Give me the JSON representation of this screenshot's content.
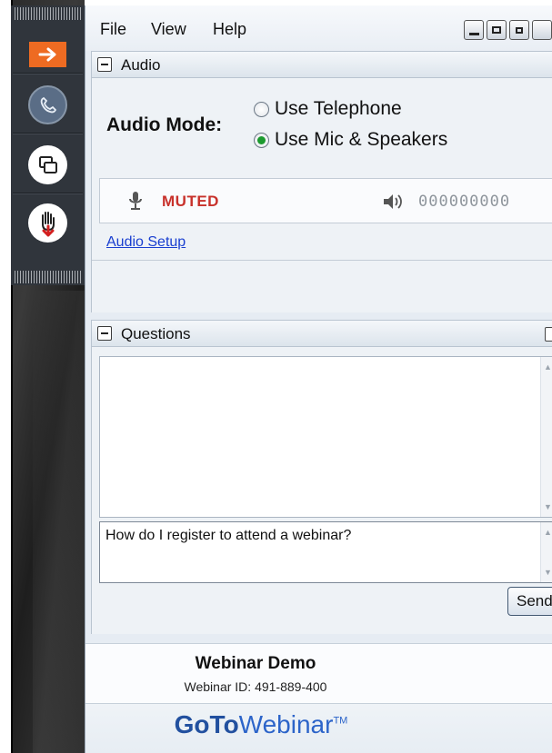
{
  "menu": {
    "items": [
      "File",
      "View",
      "Help"
    ]
  },
  "audio": {
    "section_title": "Audio",
    "mode_label": "Audio Mode:",
    "options": [
      "Use Telephone",
      "Use Mic & Speakers"
    ],
    "selected": "Use Mic & Speakers",
    "mic_status": "MUTED",
    "speaker_level": "000000000",
    "setup_link": "Audio Setup"
  },
  "questions": {
    "section_title": "Questions",
    "input_value": "How do I register to attend a webinar?",
    "send_label": "Send"
  },
  "webinar": {
    "title": "Webinar Demo",
    "id_line": "Webinar ID: 491-889-400",
    "brand_bold": "GoTo",
    "brand_light": "Webinar",
    "brand_tm": "TM"
  },
  "colors": {
    "accent_orange": "#ee6b22",
    "muted_red": "#c8312b",
    "link_blue": "#1a3fd0",
    "brand_blue": "#2c64c9"
  },
  "grab_tab": {
    "icons": [
      "arrow-right-icon",
      "phone-icon",
      "screen-share-icon",
      "raise-hand-icon"
    ]
  }
}
